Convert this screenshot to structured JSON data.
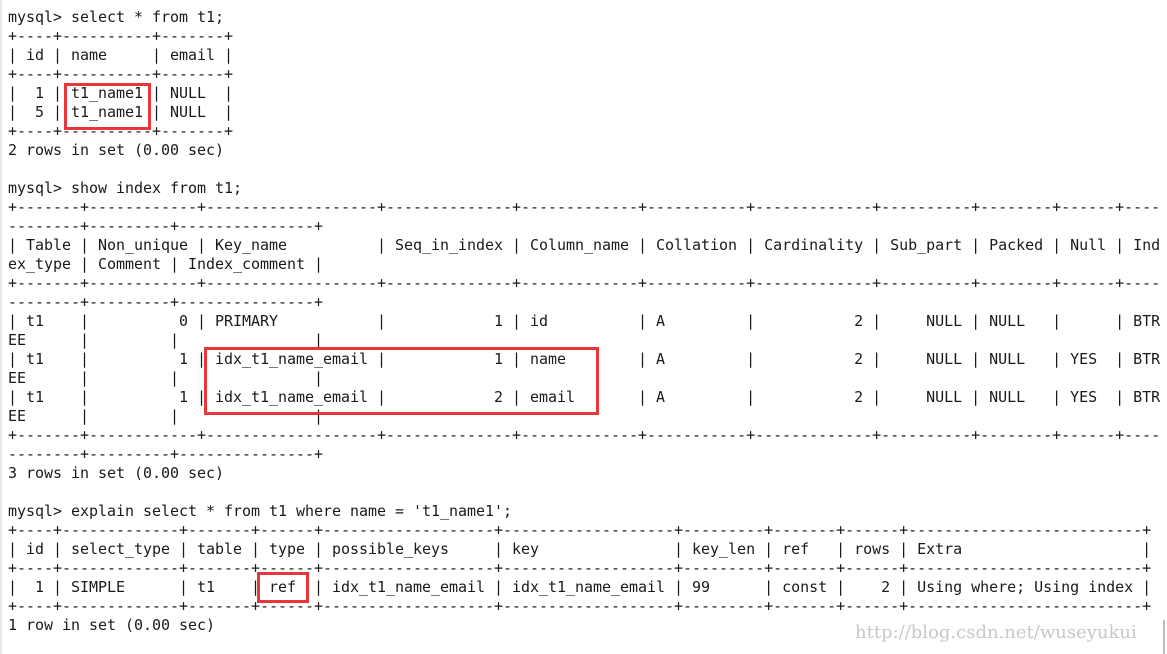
{
  "terminal": {
    "lines": [
      "mysql> select * from t1;",
      "+----+----------+-------+",
      "| id | name     | email |",
      "+----+----------+-------+",
      "|  1 | t1_name1 | NULL  |",
      "|  5 | t1_name1 | NULL  |",
      "+----+----------+-------+",
      "2 rows in set (0.00 sec)",
      "",
      "mysql> show index from t1;",
      "+-------+------------+-------------------+--------------+-------------+-----------+-------------+----------+--------+------+----",
      "--------+---------+---------------+",
      "| Table | Non_unique | Key_name          | Seq_in_index | Column_name | Collation | Cardinality | Sub_part | Packed | Null | Ind",
      "ex_type | Comment | Index_comment |",
      "+-------+------------+-------------------+--------------+-------------+-----------+-------------+----------+--------+------+----",
      "--------+---------+---------------+",
      "| t1    |          0 | PRIMARY           |            1 | id          | A         |           2 |     NULL | NULL   |      | BTR",
      "EE      |         |               |",
      "| t1    |          1 | idx_t1_name_email |            1 | name        | A         |           2 |     NULL | NULL   | YES  | BTR",
      "EE      |         |               |",
      "| t1    |          1 | idx_t1_name_email |            2 | email       | A         |           2 |     NULL | NULL   | YES  | BTR",
      "EE      |         |               |",
      "+-------+------------+-------------------+--------------+-------------+-----------+-------------+----------+--------+------+----",
      "--------+---------+---------------+",
      "3 rows in set (0.00 sec)",
      "",
      "mysql> explain select * from t1 where name = 't1_name1';",
      "+----+-------------+-------+------+-------------------+-------------------+---------+-------+------+--------------------------+",
      "| id | select_type | table | type | possible_keys     | key               | key_len | ref   | rows | Extra                    |",
      "+----+-------------+-------+------+-------------------+-------------------+---------+-------+------+--------------------------+",
      "|  1 | SIMPLE      | t1    | ref  | idx_t1_name_email | idx_t1_name_email | 99      | const |    2 | Using where; Using index |",
      "+----+-------------+-------+------+-------------------+-------------------+---------+-------+------+--------------------------+",
      "1 row in set (0.00 sec)"
    ]
  },
  "highlights": [
    {
      "target": "t1_name1 values in name column"
    },
    {
      "target": "idx_t1_name_email rows (name, email)"
    },
    {
      "target": "explain type ref"
    }
  ],
  "highlight_color": "#e8373a",
  "watermark": "http://blog.csdn.net/wuseyukui"
}
